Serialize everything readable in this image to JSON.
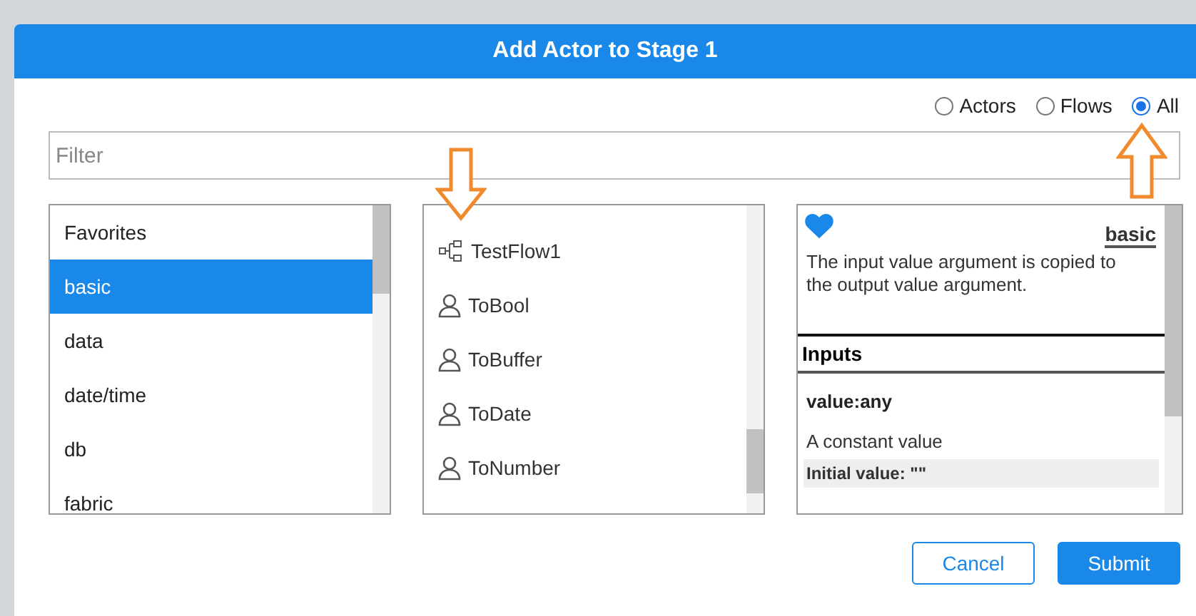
{
  "dialog": {
    "title": "Add Actor to Stage 1"
  },
  "filter_options": [
    {
      "label": "Actors",
      "selected": false
    },
    {
      "label": "Flows",
      "selected": false
    },
    {
      "label": "All",
      "selected": true
    }
  ],
  "filter": {
    "placeholder": "Filter"
  },
  "categories": [
    {
      "label": "Favorites",
      "selected": false
    },
    {
      "label": "basic",
      "selected": true
    },
    {
      "label": "data",
      "selected": false
    },
    {
      "label": "date/time",
      "selected": false
    },
    {
      "label": "db",
      "selected": false
    },
    {
      "label": "fabric",
      "selected": false
    }
  ],
  "items": [
    {
      "label": "TestFlow1",
      "kind": "flow"
    },
    {
      "label": "ToBool",
      "kind": "actor"
    },
    {
      "label": "ToBuffer",
      "kind": "actor"
    },
    {
      "label": "ToDate",
      "kind": "actor"
    },
    {
      "label": "ToNumber",
      "kind": "actor"
    }
  ],
  "details": {
    "favorite": true,
    "category": "basic",
    "description": "The input value argument is copied to the output value argument.",
    "inputs_heading": "Inputs",
    "input_name": "value:any",
    "input_description": "A constant value",
    "initial_value": "Initial value: \"\""
  },
  "buttons": [
    {
      "label": "Cancel",
      "kind": "secondary"
    },
    {
      "label": "Submit",
      "kind": "primary"
    }
  ]
}
